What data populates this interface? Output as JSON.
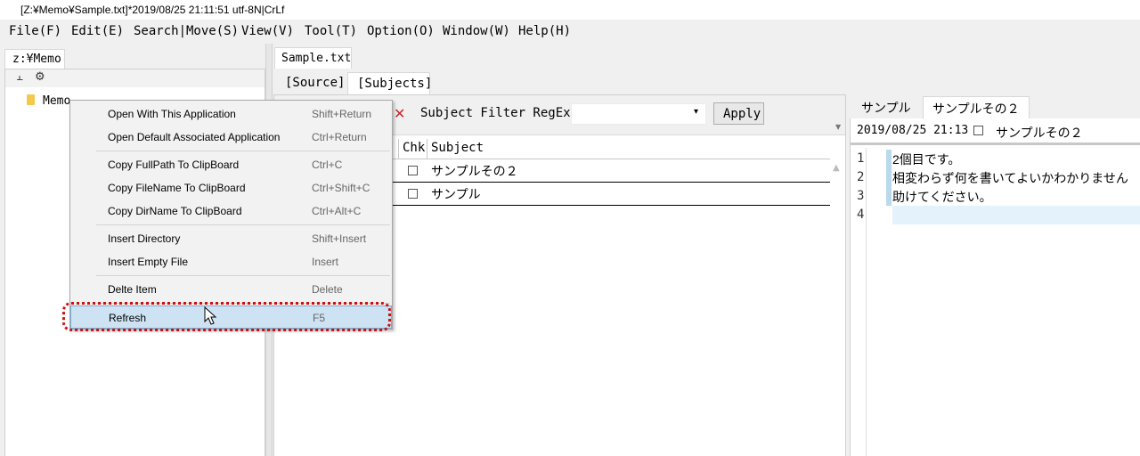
{
  "titlebar": {
    "text": "[Z:¥Memo¥Sample.txt]*2019/08/25 21:11:51 utf-8N|CrLf"
  },
  "menubar": {
    "items": [
      {
        "label": "File(F)"
      },
      {
        "label": "Edit(E)"
      },
      {
        "label": "Search|Move(S)"
      },
      {
        "label": "View(V)"
      },
      {
        "label": "Tool(T)"
      },
      {
        "label": "Option(O)"
      },
      {
        "label": "Window(W)"
      },
      {
        "label": "Help(H)"
      }
    ]
  },
  "left_pane": {
    "tab_label": "z:¥Memo",
    "toolbar_icons": [
      "tree-icon",
      "gear-icon"
    ],
    "tree": [
      {
        "label": "Memo",
        "icon": "folder-icon"
      }
    ]
  },
  "context_menu": {
    "items": [
      {
        "label": "Open With This Application",
        "shortcut": "Shift+Return"
      },
      {
        "label": "Open Default Associated Application",
        "shortcut": "Ctrl+Return"
      },
      {
        "label": "Copy FullPath To ClipBoard",
        "shortcut": "Ctrl+C"
      },
      {
        "label": "Copy FileName To ClipBoard",
        "shortcut": "Ctrl+Shift+C"
      },
      {
        "label": "Copy DirName To ClipBoard",
        "shortcut": "Ctrl+Alt+C"
      },
      {
        "label": "Insert Directory",
        "shortcut": "Shift+Insert"
      },
      {
        "label": "Insert Empty File",
        "shortcut": "Insert"
      },
      {
        "label": "Delte Item",
        "shortcut": "Delete"
      },
      {
        "label": "Refresh",
        "shortcut": "F5",
        "selected": true
      }
    ]
  },
  "document": {
    "tab_label": "Sample.txt",
    "view_tabs": [
      {
        "label": "[Source]"
      },
      {
        "label": "[Subjects]",
        "active": true
      }
    ],
    "filter": {
      "label": "Subject Filter RegEx:",
      "value": "",
      "apply_label": "Apply"
    },
    "grid": {
      "columns": [
        "Chk",
        "Subject"
      ],
      "rows": [
        {
          "checked": false,
          "subject": "サンプルその２"
        },
        {
          "checked": false,
          "subject": "サンプル"
        }
      ]
    }
  },
  "right_pane": {
    "tabs": [
      {
        "label": "サンプル"
      },
      {
        "label": "サンプルその２",
        "active": true
      }
    ],
    "info": {
      "date": "2019/08/25 21:13",
      "checked": false,
      "title": "サンプルその２"
    },
    "lines": [
      {
        "no": "1",
        "text": "2個目です。"
      },
      {
        "no": "2",
        "text": "相変わらず何を書いてよいかわかりません"
      },
      {
        "no": "3",
        "text": "助けてください。"
      },
      {
        "no": "4",
        "text": ""
      }
    ]
  },
  "colors": {
    "selection": "#cde3f4",
    "highlight_ring": "#cc1111",
    "line_marker": "#b9d9ec"
  }
}
